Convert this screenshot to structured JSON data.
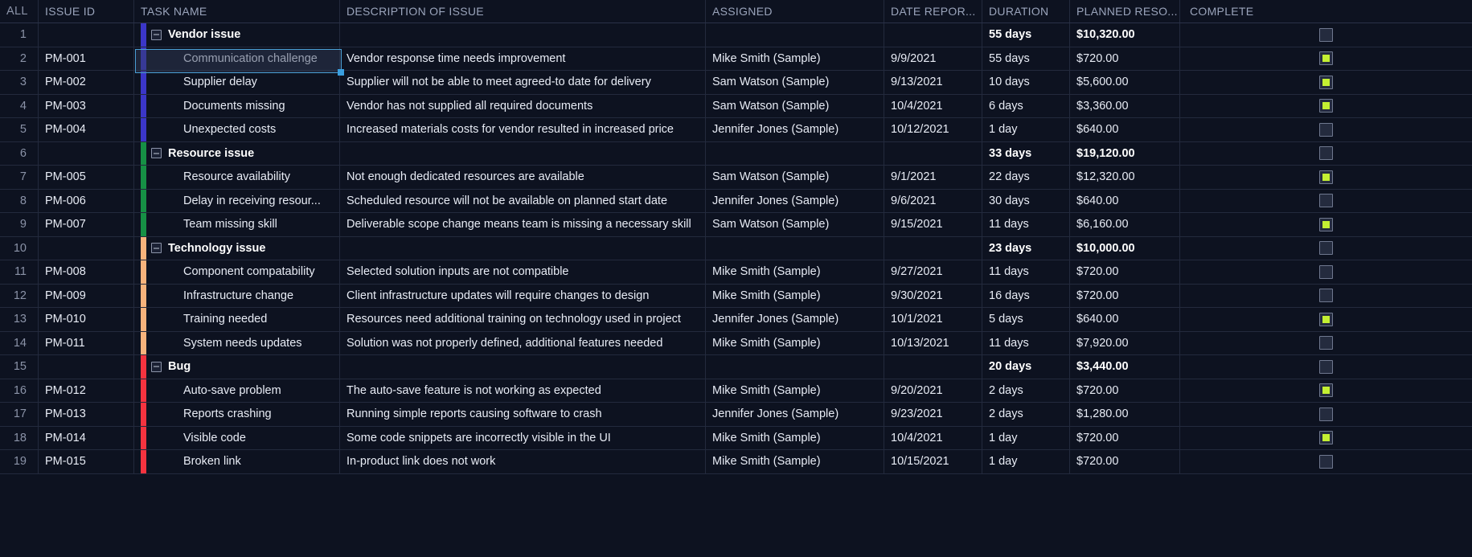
{
  "table": {
    "columns": [
      {
        "key": "all",
        "label": "ALL"
      },
      {
        "key": "id",
        "label": "ISSUE ID"
      },
      {
        "key": "task",
        "label": "TASK NAME"
      },
      {
        "key": "desc",
        "label": "DESCRIPTION OF ISSUE"
      },
      {
        "key": "asgn",
        "label": "ASSIGNED"
      },
      {
        "key": "date",
        "label": "DATE REPOR..."
      },
      {
        "key": "dur",
        "label": "DURATION"
      },
      {
        "key": "plan",
        "label": "PLANNED RESO..."
      },
      {
        "key": "comp",
        "label": "COMPLETE"
      }
    ],
    "group_colors": {
      "vendor": "#3b36c8",
      "resource": "#169045",
      "technology": "#f7b37c",
      "bug": "#f5333f"
    },
    "accent_selection": "#4a9fd4",
    "checkbox_fill": "#c4f032",
    "collapse_icon": "minus-box-icon",
    "rows": [
      {
        "num": "1",
        "id": "",
        "task": "Vendor issue",
        "desc": "",
        "asgn": "",
        "date": "",
        "dur": "55 days",
        "plan": "$10,320.00",
        "complete": false,
        "type": "group",
        "group": "vendor"
      },
      {
        "num": "2",
        "id": "PM-001",
        "task": "Communication challenge",
        "desc": "Vendor response time needs improvement",
        "asgn": "Mike Smith (Sample)",
        "date": "9/9/2021",
        "dur": "55 days",
        "plan": "$720.00",
        "complete": true,
        "type": "child",
        "group": "vendor",
        "selected": true
      },
      {
        "num": "3",
        "id": "PM-002",
        "task": "Supplier delay",
        "desc": "Supplier will not be able to meet agreed-to date for delivery",
        "asgn": "Sam Watson (Sample)",
        "date": "9/13/2021",
        "dur": "10 days",
        "plan": "$5,600.00",
        "complete": true,
        "type": "child",
        "group": "vendor"
      },
      {
        "num": "4",
        "id": "PM-003",
        "task": "Documents missing",
        "desc": "Vendor has not supplied all required documents",
        "asgn": "Sam Watson (Sample)",
        "date": "10/4/2021",
        "dur": "6 days",
        "plan": "$3,360.00",
        "complete": true,
        "type": "child",
        "group": "vendor"
      },
      {
        "num": "5",
        "id": "PM-004",
        "task": "Unexpected costs",
        "desc": "Increased materials costs for vendor resulted in increased price",
        "asgn": "Jennifer Jones (Sample)",
        "date": "10/12/2021",
        "dur": "1 day",
        "plan": "$640.00",
        "complete": false,
        "type": "child",
        "group": "vendor"
      },
      {
        "num": "6",
        "id": "",
        "task": "Resource issue",
        "desc": "",
        "asgn": "",
        "date": "",
        "dur": "33 days",
        "plan": "$19,120.00",
        "complete": false,
        "type": "group",
        "group": "resource"
      },
      {
        "num": "7",
        "id": "PM-005",
        "task": "Resource availability",
        "desc": "Not enough dedicated resources are available",
        "asgn": "Sam Watson (Sample)",
        "date": "9/1/2021",
        "dur": "22 days",
        "plan": "$12,320.00",
        "complete": true,
        "type": "child",
        "group": "resource"
      },
      {
        "num": "8",
        "id": "PM-006",
        "task": "Delay in receiving resour...",
        "desc": "Scheduled resource will not be available on planned start date",
        "asgn": "Jennifer Jones (Sample)",
        "date": "9/6/2021",
        "dur": "30 days",
        "plan": "$640.00",
        "complete": false,
        "type": "child",
        "group": "resource"
      },
      {
        "num": "9",
        "id": "PM-007",
        "task": "Team missing skill",
        "desc": "Deliverable scope change means team is missing a necessary skill",
        "asgn": "Sam Watson (Sample)",
        "date": "9/15/2021",
        "dur": "11 days",
        "plan": "$6,160.00",
        "complete": true,
        "type": "child",
        "group": "resource"
      },
      {
        "num": "10",
        "id": "",
        "task": "Technology issue",
        "desc": "",
        "asgn": "",
        "date": "",
        "dur": "23 days",
        "plan": "$10,000.00",
        "complete": false,
        "type": "group",
        "group": "technology"
      },
      {
        "num": "11",
        "id": "PM-008",
        "task": "Component compatability",
        "desc": "Selected solution inputs are not compatible",
        "asgn": "Mike Smith (Sample)",
        "date": "9/27/2021",
        "dur": "11 days",
        "plan": "$720.00",
        "complete": false,
        "type": "child",
        "group": "technology"
      },
      {
        "num": "12",
        "id": "PM-009",
        "task": "Infrastructure change",
        "desc": "Client infrastructure updates will require changes to design",
        "asgn": "Mike Smith (Sample)",
        "date": "9/30/2021",
        "dur": "16 days",
        "plan": "$720.00",
        "complete": false,
        "type": "child",
        "group": "technology"
      },
      {
        "num": "13",
        "id": "PM-010",
        "task": "Training needed",
        "desc": "Resources need additional training on technology used in project",
        "asgn": "Jennifer Jones (Sample)",
        "date": "10/1/2021",
        "dur": "5 days",
        "plan": "$640.00",
        "complete": true,
        "type": "child",
        "group": "technology"
      },
      {
        "num": "14",
        "id": "PM-011",
        "task": "System needs updates",
        "desc": "Solution was not properly defined, additional features needed",
        "asgn": "Mike Smith (Sample)",
        "date": "10/13/2021",
        "dur": "11 days",
        "plan": "$7,920.00",
        "complete": false,
        "type": "child",
        "group": "technology"
      },
      {
        "num": "15",
        "id": "",
        "task": "Bug",
        "desc": "",
        "asgn": "",
        "date": "",
        "dur": "20 days",
        "plan": "$3,440.00",
        "complete": false,
        "type": "group",
        "group": "bug"
      },
      {
        "num": "16",
        "id": "PM-012",
        "task": "Auto-save problem",
        "desc": "The auto-save feature is not working as expected",
        "asgn": "Mike Smith (Sample)",
        "date": "9/20/2021",
        "dur": "2 days",
        "plan": "$720.00",
        "complete": true,
        "type": "child",
        "group": "bug"
      },
      {
        "num": "17",
        "id": "PM-013",
        "task": "Reports crashing",
        "desc": "Running simple reports causing software to crash",
        "asgn": "Jennifer Jones (Sample)",
        "date": "9/23/2021",
        "dur": "2 days",
        "plan": "$1,280.00",
        "complete": false,
        "type": "child",
        "group": "bug"
      },
      {
        "num": "18",
        "id": "PM-014",
        "task": "Visible code",
        "desc": "Some code snippets are incorrectly visible in the UI",
        "asgn": "Mike Smith (Sample)",
        "date": "10/4/2021",
        "dur": "1 day",
        "plan": "$720.00",
        "complete": true,
        "type": "child",
        "group": "bug"
      },
      {
        "num": "19",
        "id": "PM-015",
        "task": "Broken link",
        "desc": "In-product link does not work",
        "asgn": "Mike Smith (Sample)",
        "date": "10/15/2021",
        "dur": "1 day",
        "plan": "$720.00",
        "complete": false,
        "type": "child",
        "group": "bug"
      }
    ]
  }
}
